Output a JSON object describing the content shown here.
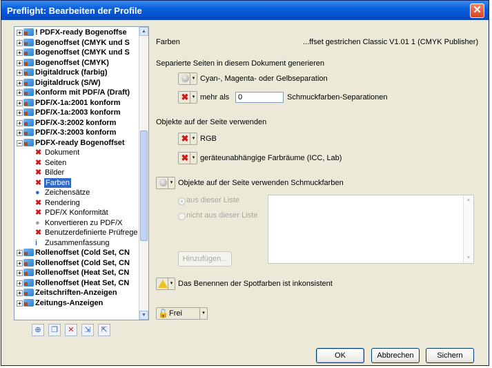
{
  "window": {
    "title": "Preflight: Bearbeiten der Profile",
    "close_symbol": "✕"
  },
  "tree": {
    "items": [
      {
        "label": "! PDFX-ready Bogenoffse",
        "level": 0,
        "expand": "+",
        "bold": true
      },
      {
        "label": "Bogenoffset (CMYK und S",
        "level": 0,
        "expand": "+",
        "bold": true
      },
      {
        "label": "Bogenoffset (CMYK und S",
        "level": 0,
        "expand": "+",
        "bold": true
      },
      {
        "label": "Bogenoffset (CMYK)",
        "level": 0,
        "expand": "+",
        "bold": true
      },
      {
        "label": "Digitaldruck (farbig)",
        "level": 0,
        "expand": "+",
        "bold": true
      },
      {
        "label": "Digitaldruck (S/W)",
        "level": 0,
        "expand": "+",
        "bold": true
      },
      {
        "label": "Konform mit PDF/A (Draft)",
        "level": 0,
        "expand": "+",
        "bold": true
      },
      {
        "label": "PDF/X-1a:2001 konform",
        "level": 0,
        "expand": "+",
        "bold": true
      },
      {
        "label": "PDF/X-1a:2003 konform",
        "level": 0,
        "expand": "+",
        "bold": true
      },
      {
        "label": "PDF/X-3:2002 konform",
        "level": 0,
        "expand": "+",
        "bold": true
      },
      {
        "label": "PDF/X-3:2003 konform",
        "level": 0,
        "expand": "+",
        "bold": true
      },
      {
        "label": "PDFX-ready Bogenoffset",
        "level": 0,
        "expand": "−",
        "bold": true
      },
      {
        "label": "Dokument",
        "level": 1,
        "icon": "red-x",
        "glyph": "✖"
      },
      {
        "label": "Seiten",
        "level": 1,
        "icon": "red-x",
        "glyph": "✖"
      },
      {
        "label": "Bilder",
        "level": 1,
        "icon": "red-x",
        "glyph": "✖"
      },
      {
        "label": "Farben",
        "level": 1,
        "icon": "red-x",
        "glyph": "✖",
        "selected": true
      },
      {
        "label": "Zeichensätze",
        "level": 1,
        "icon": "blue-info",
        "glyph": "●"
      },
      {
        "label": "Rendering",
        "level": 1,
        "icon": "red-x",
        "glyph": "✖"
      },
      {
        "label": "PDF/X Konformität",
        "level": 1,
        "icon": "red-x",
        "glyph": "✖"
      },
      {
        "label": "Konvertieren zu PDF/X",
        "level": 1,
        "icon": "gray-dot",
        "glyph": "●"
      },
      {
        "label": "Benutzerdefinierte Prüfrege",
        "level": 1,
        "icon": "red-x",
        "glyph": "✖"
      },
      {
        "label": "Zusammenfassung",
        "level": 1,
        "icon": "summary",
        "glyph": "i"
      },
      {
        "label": "Rollenoffset (Cold Set, CN",
        "level": 0,
        "expand": "+",
        "bold": true
      },
      {
        "label": "Rollenoffset (Cold Set, CN",
        "level": 0,
        "expand": "+",
        "bold": true
      },
      {
        "label": "Rollenoffset (Heat Set, CN",
        "level": 0,
        "expand": "+",
        "bold": true
      },
      {
        "label": "Rollenoffset (Heat Set, CN",
        "level": 0,
        "expand": "+",
        "bold": true
      },
      {
        "label": "Zeitschriften-Anzeigen",
        "level": 0,
        "expand": "+",
        "bold": true
      },
      {
        "label": "Zeitungs-Anzeigen",
        "level": 0,
        "expand": "+",
        "bold": true
      }
    ],
    "scroll_up": "▲",
    "scroll_down": "▼"
  },
  "tree_toolbar": [
    {
      "name": "new-profile-icon",
      "glyph": "⊕",
      "color": "#2a63b8"
    },
    {
      "name": "duplicate-profile-icon",
      "glyph": "❐",
      "color": "#2a63b8"
    },
    {
      "name": "delete-profile-icon",
      "glyph": "✕",
      "color": "#c0202a"
    },
    {
      "name": "import-profile-icon",
      "glyph": "⇲",
      "color": "#2a63b8"
    },
    {
      "name": "export-profile-icon",
      "glyph": "⇱",
      "color": "#2a63b8"
    }
  ],
  "panel": {
    "section": "Farben",
    "profile_name": "...ffset gestrichen Classic V1.01 1 (CMYK Publisher)",
    "separated_heading": "Separierte Seiten in diesem Dokument generieren",
    "cmy_label": "Cyan-, Magenta- oder Gelbseparation",
    "more_than_label": "mehr als",
    "more_than_value": "0",
    "spot_sep_label": "Schmuckfarben-Separationen",
    "objects_heading": "Objekte auf der Seite verwenden",
    "rgb_label": "RGB",
    "device_indep_label": "geräteunabhängige Farbräume (ICC, Lab)",
    "spot_objects_label": "Objekte auf der Seite verwenden Schmuckfarben",
    "from_list_label": "aus dieser Liste",
    "not_from_list_label": "nicht aus dieser Liste",
    "add_button": "Hinzufügen...",
    "naming_label": "Das Benennen der Spotfarben ist inkonsistent",
    "lock_value": "Frei",
    "ok": "OK",
    "cancel": "Abbrechen",
    "save": "Sichern",
    "red_x_glyph": "✖",
    "caret_glyph": "▾",
    "list_up": "▲",
    "list_down": "▼"
  },
  "colors": {
    "accent": "#0a5fdc",
    "error": "#cc1b1b",
    "selection": "#316ac5",
    "warning": "#f0c020"
  }
}
